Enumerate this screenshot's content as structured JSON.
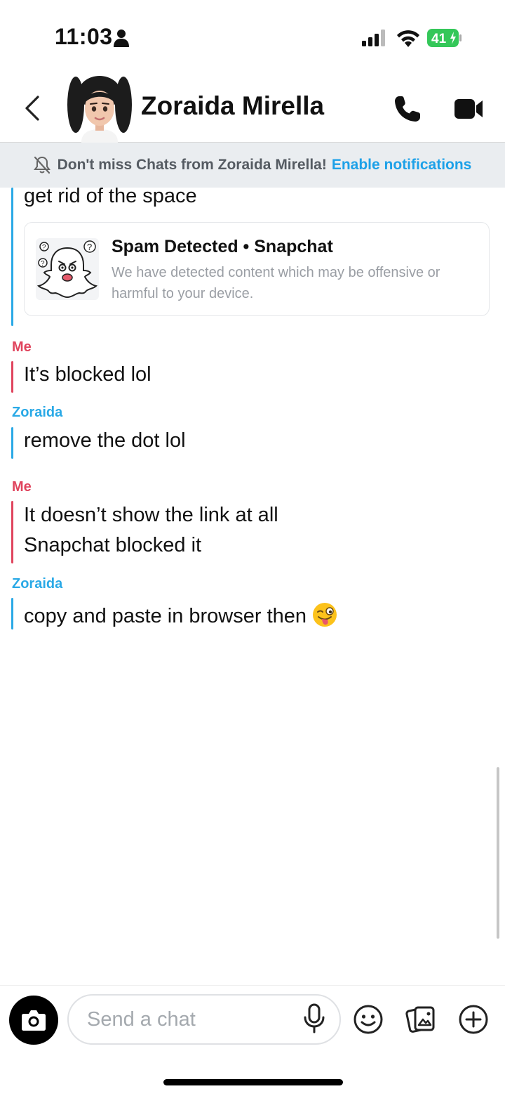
{
  "status_bar": {
    "time": "11:03",
    "battery_level": "41"
  },
  "header": {
    "contact_name": "Zoraida Mirella"
  },
  "banner": {
    "text": "Don't miss Chats from Zoraida Mirella!",
    "link_text": "Enable notifications"
  },
  "messages": [
    {
      "text": "get rid of the space"
    },
    {
      "sender": "Me",
      "text": "It’s blocked lol"
    },
    {
      "sender": "Zoraida",
      "text": "remove the dot lol"
    },
    {
      "sender": "Me",
      "lines": [
        "It doesn’t show the link at all",
        "Snapchat blocked it"
      ]
    },
    {
      "sender": "Zoraida",
      "text": "copy and paste in browser then"
    }
  ],
  "link_card": {
    "title": "Spam Detected • Snapchat",
    "description": "We have detected content which may be offensive or harmful to your device."
  },
  "composer": {
    "placeholder": "Send a chat"
  },
  "colors": {
    "accent_blue": "#2aa9e6",
    "me_red": "#e0455e",
    "banner_bg": "#eaedf0"
  }
}
